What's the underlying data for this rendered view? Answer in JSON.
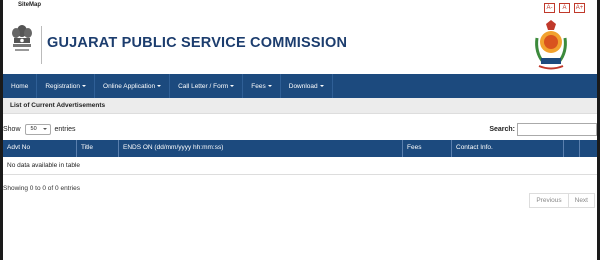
{
  "topbar": {
    "sitemap": "SiteMap",
    "font_buttons": [
      "A-",
      "A",
      "A+"
    ]
  },
  "header": {
    "title": "GUJARAT PUBLIC SERVICE COMMISSION"
  },
  "nav": [
    {
      "label": "Home",
      "dropdown": false
    },
    {
      "label": "Registration",
      "dropdown": true
    },
    {
      "label": "Online Application",
      "dropdown": true
    },
    {
      "label": "Call Letter / Form",
      "dropdown": true
    },
    {
      "label": "Fees",
      "dropdown": true
    },
    {
      "label": "Download",
      "dropdown": true
    }
  ],
  "section": {
    "title": "List of Current Advertisements"
  },
  "controls": {
    "show_label": "Show",
    "show_value": "50",
    "entries_label": "entries",
    "search_label": "Search:",
    "search_value": ""
  },
  "table": {
    "columns": [
      "Advt No",
      "Title",
      "ENDS ON (dd/mm/yyyy hh:mm:ss)",
      "Fees",
      "Contact Info.",
      "",
      ""
    ],
    "empty_message": "No data available in table"
  },
  "info": "Showing 0 to 0 of 0 entries",
  "pager": {
    "previous": "Previous",
    "next": "Next"
  },
  "colors": {
    "primary": "#1c4a7e",
    "title": "#1c3d6e",
    "font_button": "#c0392b"
  }
}
